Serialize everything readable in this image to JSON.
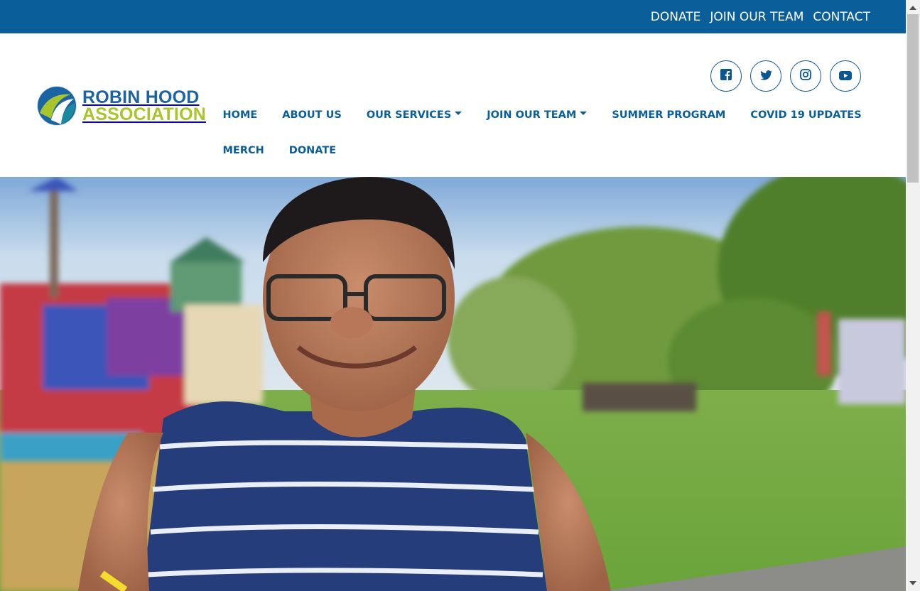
{
  "topbar": {
    "links": [
      "DONATE",
      "JOIN OUR TEAM",
      "CONTACT"
    ]
  },
  "logo": {
    "line1": "ROBIN HOOD",
    "line2": "ASSOCIATION"
  },
  "social": [
    "facebook-icon",
    "twitter-icon",
    "instagram-icon",
    "youtube-icon"
  ],
  "nav": {
    "row1": [
      "HOME",
      "ABOUT US",
      "OUR SERVICES",
      "JOIN OUR TEAM",
      "SUMMER PROGRAM",
      "COVID 19 UPDATES"
    ],
    "row2": [
      "MERCH",
      "DONATE"
    ]
  },
  "colors": {
    "brand_blue": "#0a5e99",
    "brand_green": "#a8c62b",
    "white": "#ffffff"
  }
}
